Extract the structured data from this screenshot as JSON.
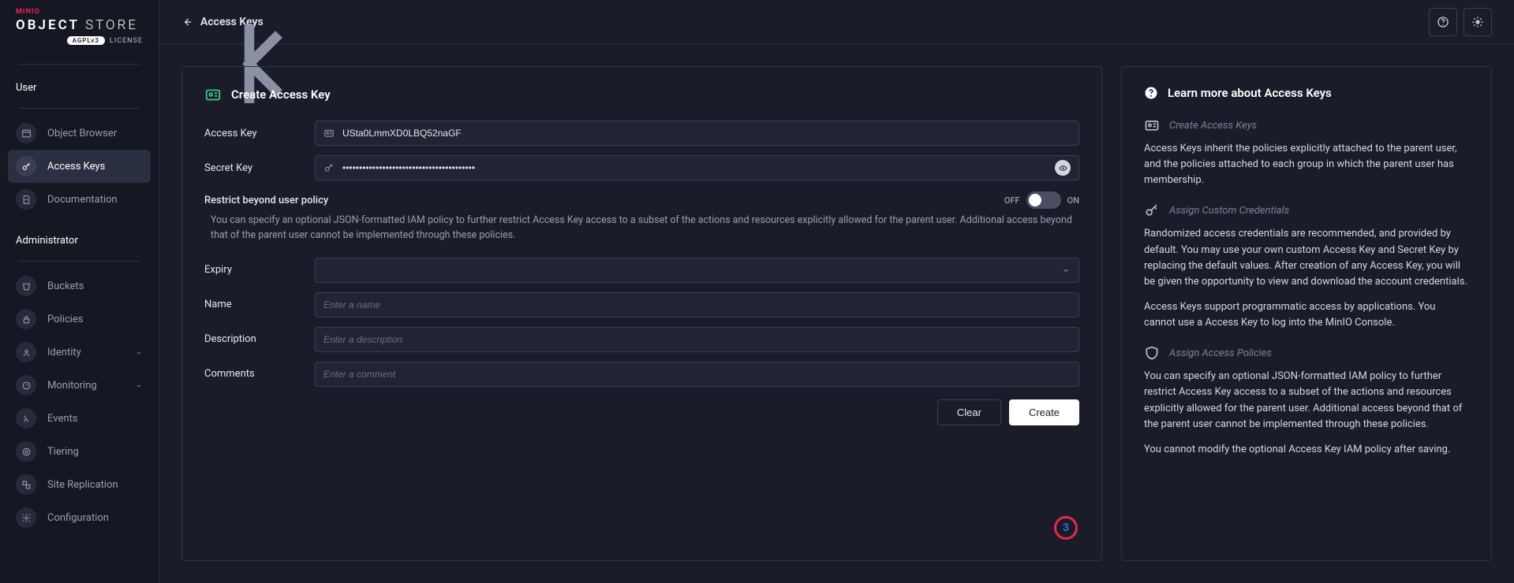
{
  "brand": {
    "minio": "MINIO",
    "object": "OBJECT",
    "store": "STORE",
    "license_pill": "AGPLv3",
    "license_text": "LICENSE"
  },
  "sidebar": {
    "sections": {
      "user": {
        "header": "User",
        "items": [
          {
            "label": "Object Browser",
            "icon": "browser-icon"
          },
          {
            "label": "Access Keys",
            "icon": "key-icon"
          },
          {
            "label": "Documentation",
            "icon": "doc-icon"
          }
        ]
      },
      "admin": {
        "header": "Administrator",
        "items": [
          {
            "label": "Buckets",
            "icon": "bucket-icon"
          },
          {
            "label": "Policies",
            "icon": "lock-icon"
          },
          {
            "label": "Identity",
            "icon": "identity-icon",
            "expandable": true
          },
          {
            "label": "Monitoring",
            "icon": "monitor-icon",
            "expandable": true
          },
          {
            "label": "Events",
            "icon": "lambda-icon"
          },
          {
            "label": "Tiering",
            "icon": "tier-icon"
          },
          {
            "label": "Site Replication",
            "icon": "replicate-icon"
          },
          {
            "label": "Configuration",
            "icon": "gear-icon"
          }
        ]
      }
    }
  },
  "header": {
    "breadcrumb": "Access Keys"
  },
  "form": {
    "title": "Create Access Key",
    "access_key": {
      "label": "Access Key",
      "value": "USta0LmmXD0LBQ52naGF"
    },
    "secret_key": {
      "label": "Secret Key",
      "value": "••••••••••••••••••••••••••••••••••••••••"
    },
    "restrict": {
      "label": "Restrict beyond user policy",
      "desc": "You can specify an optional JSON-formatted IAM policy to further restrict Access Key access to a subset of the actions and resources explicitly allowed for the parent user. Additional access beyond that of the parent user cannot be implemented through these policies.",
      "off": "OFF",
      "on": "ON"
    },
    "expiry": {
      "label": "Expiry",
      "value": ""
    },
    "name": {
      "label": "Name",
      "placeholder": "Enter a name"
    },
    "description": {
      "label": "Description",
      "placeholder": "Enter a description"
    },
    "comments": {
      "label": "Comments",
      "placeholder": "Enter a comment"
    },
    "actions": {
      "clear": "Clear",
      "create": "Create"
    },
    "badge": "3"
  },
  "help": {
    "title": "Learn more about Access Keys",
    "s1": {
      "head": "Create Access Keys",
      "body": "Access Keys inherit the policies explicitly attached to the parent user, and the policies attached to each group in which the parent user has membership."
    },
    "s2": {
      "head": "Assign Custom Credentials",
      "body1": "Randomized access credentials are recommended, and provided by default. You may use your own custom Access Key and Secret Key by replacing the default values. After creation of any Access Key, you will be given the opportunity to view and download the account credentials.",
      "body2": "Access Keys support programmatic access by applications. You cannot use a Access Key to log into the MinIO Console."
    },
    "s3": {
      "head": "Assign Access Policies",
      "body1": "You can specify an optional JSON-formatted IAM policy to further restrict Access Key access to a subset of the actions and resources explicitly allowed for the parent user. Additional access beyond that of the parent user cannot be implemented through these policies.",
      "body2": "You cannot modify the optional Access Key IAM policy after saving."
    }
  }
}
